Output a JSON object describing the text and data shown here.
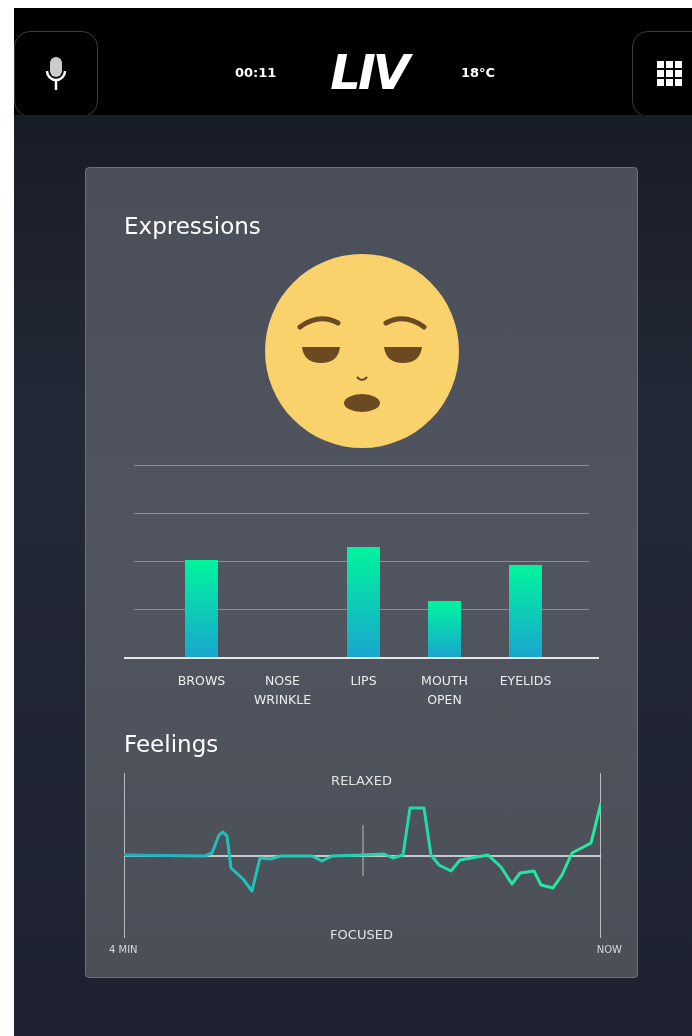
{
  "top_bar": {
    "time": "00:11",
    "logo": "LIV",
    "temperature": "18°C"
  },
  "expressions": {
    "title": "Expressions",
    "bars": [
      {
        "label": "BROWS"
      },
      {
        "label": "NOSE WRINKLE"
      },
      {
        "label": "LIPS"
      },
      {
        "label": "MOUTH OPEN"
      },
      {
        "label": "EYELIDS"
      }
    ]
  },
  "feelings": {
    "title": "Feelings",
    "top_label": "RELAXED",
    "bottom_label": "FOCUSED",
    "start_label": "4 MIN",
    "end_label": "NOW"
  }
}
